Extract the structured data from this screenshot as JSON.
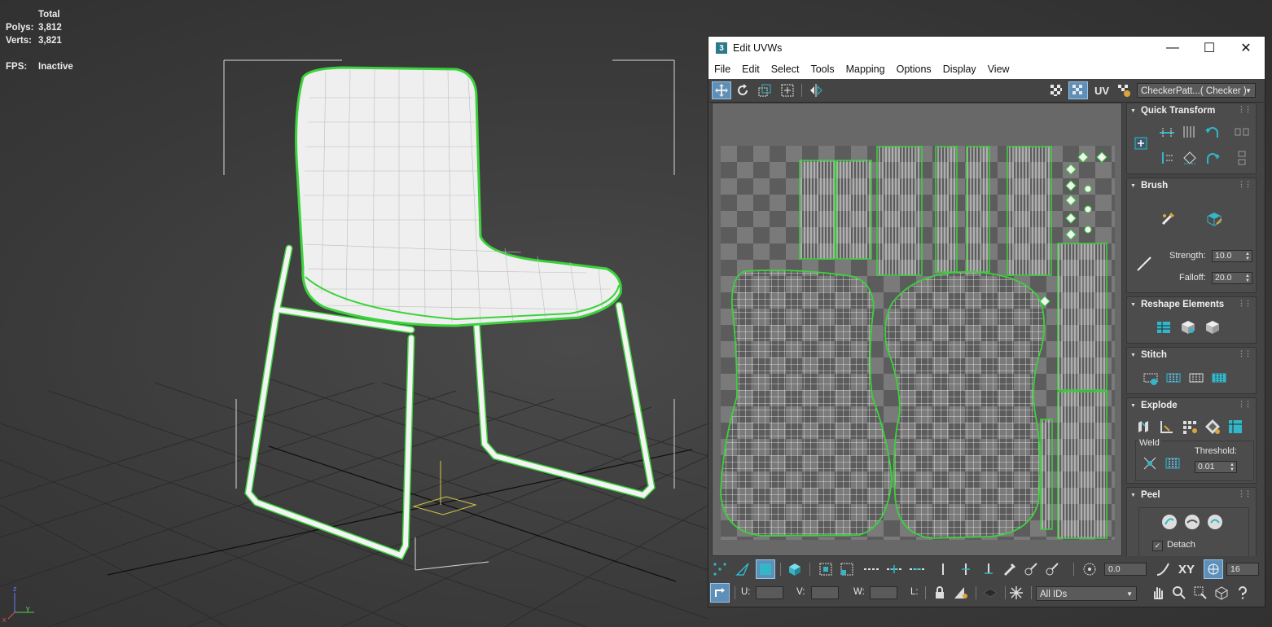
{
  "viewport": {
    "stats": {
      "header": "Total",
      "polys_label": "Polys:",
      "polys_value": "3,812",
      "verts_label": "Verts:",
      "verts_value": "3,821",
      "fps_label": "FPS:",
      "fps_value": "Inactive"
    },
    "axis_icon": "xyz-axis-tripod-icon",
    "colors": {
      "selection": "#3cd23c",
      "mesh": "#ffffff",
      "grid": "#2a2a2a"
    }
  },
  "uv_editor": {
    "title": "Edit UVWs",
    "app_icon_text": "3",
    "window_buttons": [
      "minimize-icon",
      "maximize-icon",
      "close-icon"
    ],
    "menu": [
      "File",
      "Edit",
      "Select",
      "Tools",
      "Mapping",
      "Options",
      "Display",
      "View"
    ],
    "toolbar": {
      "left_tools": [
        "move-icon",
        "rotate-icon",
        "scale-icon",
        "freeform-icon",
        "mirror-icon"
      ],
      "uv_label": "UV",
      "texture_dropdown": "CheckerPatt...( Checker )"
    },
    "panel": {
      "quick_transform": {
        "title": "Quick Transform"
      },
      "brush": {
        "title": "Brush",
        "strength_label": "Strength:",
        "strength_value": "10.0",
        "falloff_label": "Falloff:",
        "falloff_value": "20.0"
      },
      "reshape": {
        "title": "Reshape Elements"
      },
      "stitch": {
        "title": "Stitch"
      },
      "explode": {
        "title": "Explode",
        "weld_label": "Weld",
        "threshold_label": "Threshold:",
        "threshold_value": "0.01"
      },
      "peel": {
        "title": "Peel",
        "detach_label": "Detach",
        "detach_checked": true
      }
    },
    "bottom1": {
      "angle_value": "0.0",
      "xy_label": "XY",
      "grid_value": "16"
    },
    "bottom2": {
      "u_label": "U:",
      "v_label": "V:",
      "w_label": "W:",
      "l_label": "L:",
      "id_dropdown": "All IDs"
    },
    "accent": "#33b6c8"
  }
}
